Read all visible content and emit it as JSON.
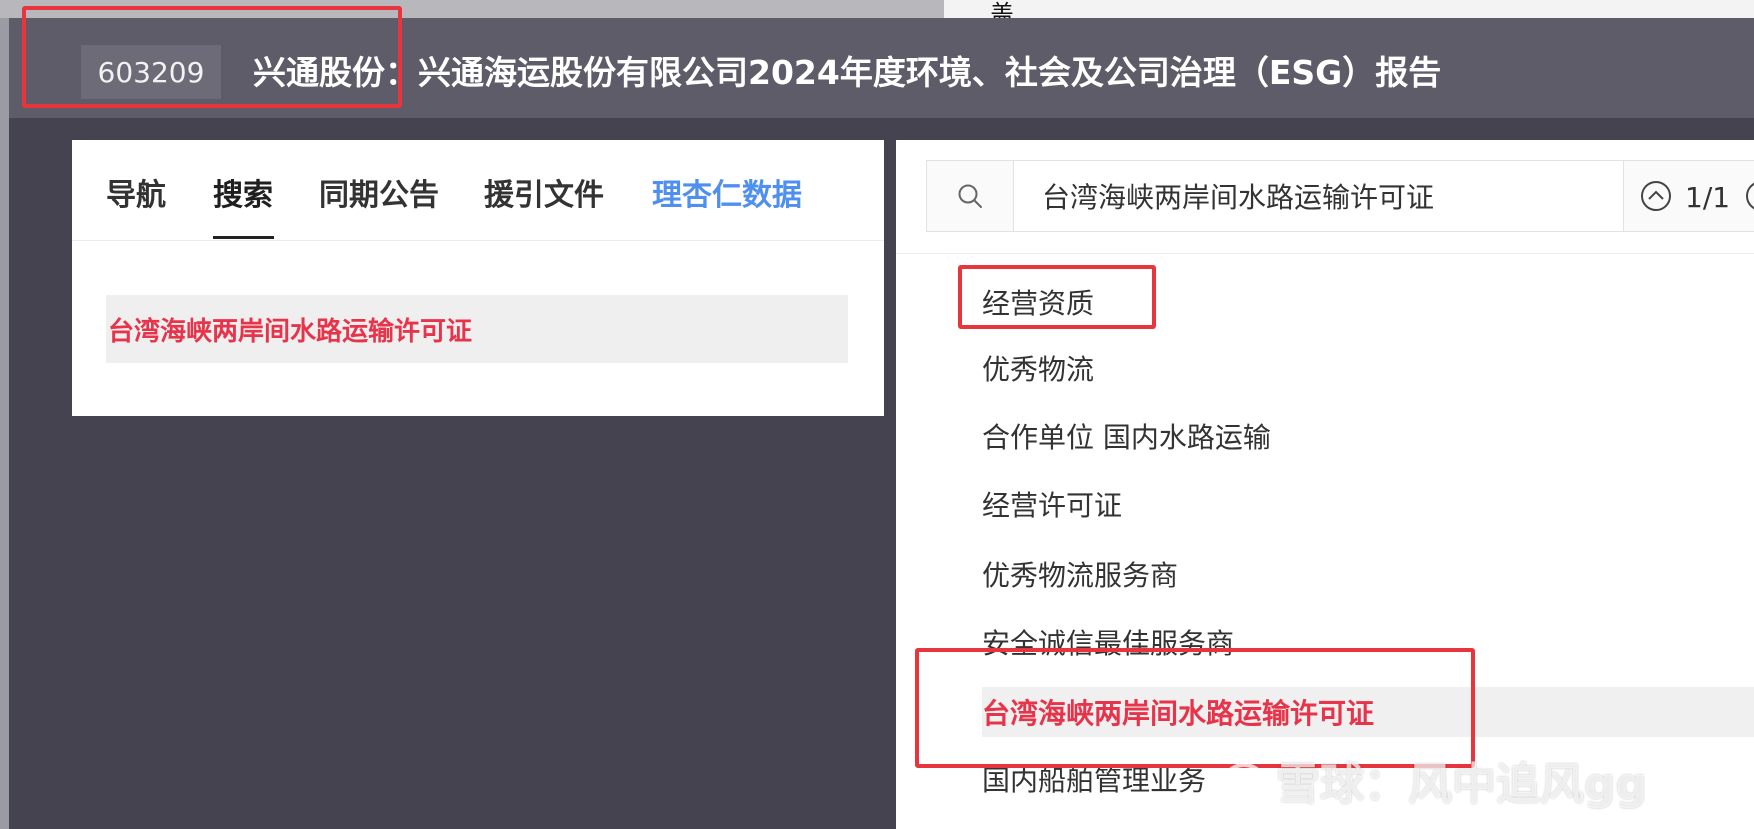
{
  "strip_glyph": "盖",
  "header": {
    "stock_code": "603209",
    "title": "兴通股份：兴通海运股份有限公司2024年度环境、社会及公司治理（ESG）报告"
  },
  "left_panel": {
    "tabs": [
      {
        "label": "导航"
      },
      {
        "label": "搜索"
      },
      {
        "label": "同期公告"
      },
      {
        "label": "援引文件"
      },
      {
        "label": "理杏仁数据"
      }
    ],
    "active_tab": "搜索",
    "search_results": [
      "台湾海峡两岸间水路运输许可证"
    ]
  },
  "right_panel": {
    "search": {
      "value": "台湾海峡两岸间水路运输许可证",
      "match_count": "1/1"
    },
    "outline": [
      "经营资质",
      "优秀物流",
      "合作单位 国内水路运输",
      "经营许可证",
      "优秀物流服务商",
      "安全诚信最佳服务商",
      "台湾海峡两岸间水路运输许可证",
      "国内船舶管理业务"
    ]
  },
  "watermark": "雪球：风中追风gg",
  "colors": {
    "highlight_red": "#e8344a",
    "annotation_red": "#e8343c",
    "brand_blue": "#4f8ff0",
    "header_bg": "#5d5c68"
  }
}
